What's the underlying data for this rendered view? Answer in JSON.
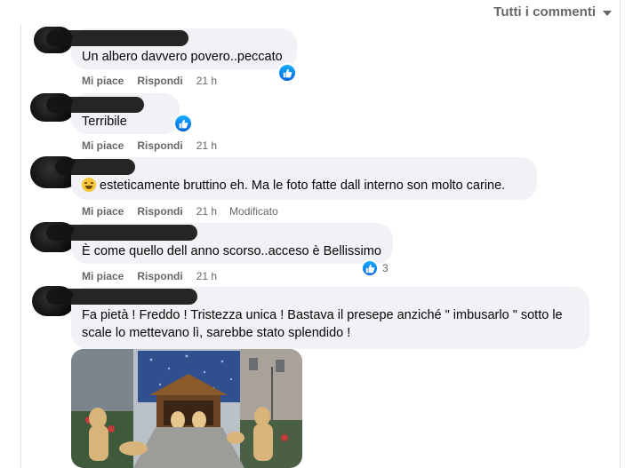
{
  "sort": {
    "label": "Tutti i commenti"
  },
  "comments": [
    {
      "author": "",
      "text": "Un albero davvero povero..peccato",
      "like": "Mi piace",
      "reply": "Rispondi",
      "time": "21 h",
      "edited": "",
      "reactions": ""
    },
    {
      "author": "",
      "text": "Terribile",
      "like": "Mi piace",
      "reply": "Rispondi",
      "time": "21 h",
      "edited": "",
      "reactions": ""
    },
    {
      "author": "",
      "text": "esteticamente bruttino eh. Ma le foto fatte dall interno son molto carine.",
      "like": "Mi piace",
      "reply": "Rispondi",
      "time": "21 h",
      "edited": "Modificato",
      "reactions": ""
    },
    {
      "author": "",
      "text": "È come quello dell anno scorso..acceso è Bellissimo",
      "like": "Mi piace",
      "reply": "Rispondi",
      "time": "21 h",
      "edited": "",
      "reactions": "3"
    },
    {
      "author": "",
      "text": "Fa pietà ! Freddo ! Tristezza unica ! Bastava il presepe anziché \" imbusarlo \" sotto le scale lo mettevano lì, sarebbe stato splendido !",
      "like": "",
      "reply": "",
      "time": "",
      "edited": "",
      "reactions": ""
    }
  ],
  "colors": {
    "like_blue": "#0866ff",
    "bubble": "#f0f2f5",
    "meta": "#65676b"
  },
  "icons": {
    "like": "thumbs-up-icon",
    "emoji": "grinning-sweat-emoji-icon",
    "sort": "caret-down-icon"
  }
}
